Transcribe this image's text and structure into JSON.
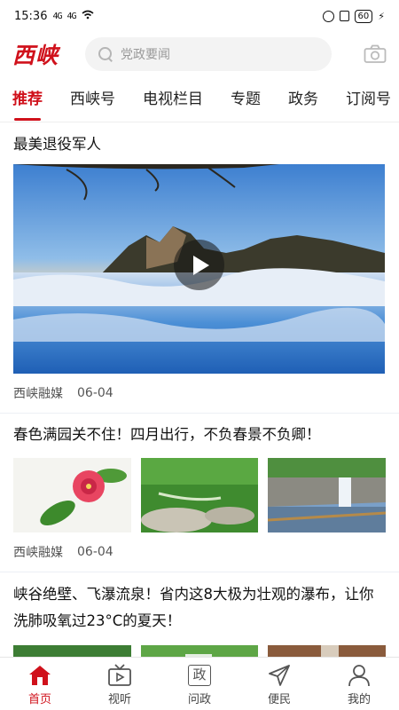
{
  "status_bar": {
    "time": "15:36",
    "signal1": "4G",
    "signal2": "4G",
    "battery": "60"
  },
  "header": {
    "logo": "西峡",
    "search_placeholder": "党政要闻"
  },
  "tabs": [
    {
      "label": "推荐",
      "active": true
    },
    {
      "label": "西峡号"
    },
    {
      "label": "电视栏目"
    },
    {
      "label": "专题"
    },
    {
      "label": "政务"
    },
    {
      "label": "订阅号"
    }
  ],
  "articles": [
    {
      "title": "最美退役军人",
      "source": "西峡融媒",
      "date": "06-04",
      "type": "video"
    },
    {
      "title": "春色满园关不住！四月出行，不负春景不负卿！",
      "source": "西峡融媒",
      "date": "06-04",
      "type": "three-image"
    },
    {
      "title": "峡谷绝壁、飞瀑流泉！省内这8大极为壮观的瀑布，让你洗肺吸氧过23°C的夏天！",
      "type": "three-image"
    }
  ],
  "bottom_nav": [
    {
      "label": "首页",
      "icon": "home-icon",
      "active": true
    },
    {
      "label": "视听",
      "icon": "tv-icon"
    },
    {
      "label": "问政",
      "icon": "zheng-icon",
      "glyph": "政"
    },
    {
      "label": "便民",
      "icon": "send-icon"
    },
    {
      "label": "我的",
      "icon": "user-icon"
    }
  ],
  "colors": {
    "accent": "#d0111b",
    "text": "#222222",
    "search_bg": "#f3f3f3"
  }
}
